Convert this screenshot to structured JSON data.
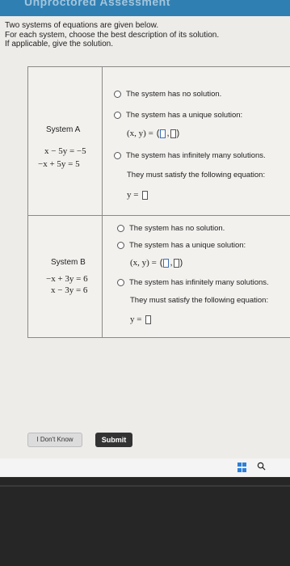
{
  "header": {
    "title": "Unproctored Assessment"
  },
  "intro": {
    "line1": "Two systems of equations are given below.",
    "line2": "For each system, choose the best description of its solution.",
    "line3": "If applicable, give the solution."
  },
  "systems": [
    {
      "name": "System A",
      "eq1": "x − 5y = −5",
      "eq2": "−x + 5y = 5",
      "options": {
        "no_solution": "The system has no solution.",
        "unique": "The system has a unique solution:",
        "unique_expr": "(x, y) =",
        "infinite": "The system has infinitely many solutions.",
        "must_satisfy": "They must satisfy the following equation:",
        "y_expr": "y ="
      }
    },
    {
      "name": "System B",
      "eq1": "−x + 3y = 6",
      "eq2": "x − 3y = 6",
      "options": {
        "no_solution": "The system has no solution.",
        "unique": "The system has a unique solution:",
        "unique_expr": "(x, y) =",
        "infinite": "The system has infinitely many solutions.",
        "must_satisfy": "They must satisfy the following equation:",
        "y_expr": "y ="
      }
    }
  ],
  "buttons": {
    "dont_know": "I Don't Know",
    "submit": "Submit"
  },
  "colors": {
    "accent": "#3b6fb5",
    "submit_bg": "#333333",
    "taskbar": "#f4f4f4"
  },
  "taskbar_icons": [
    "windows-icon",
    "search-icon"
  ]
}
